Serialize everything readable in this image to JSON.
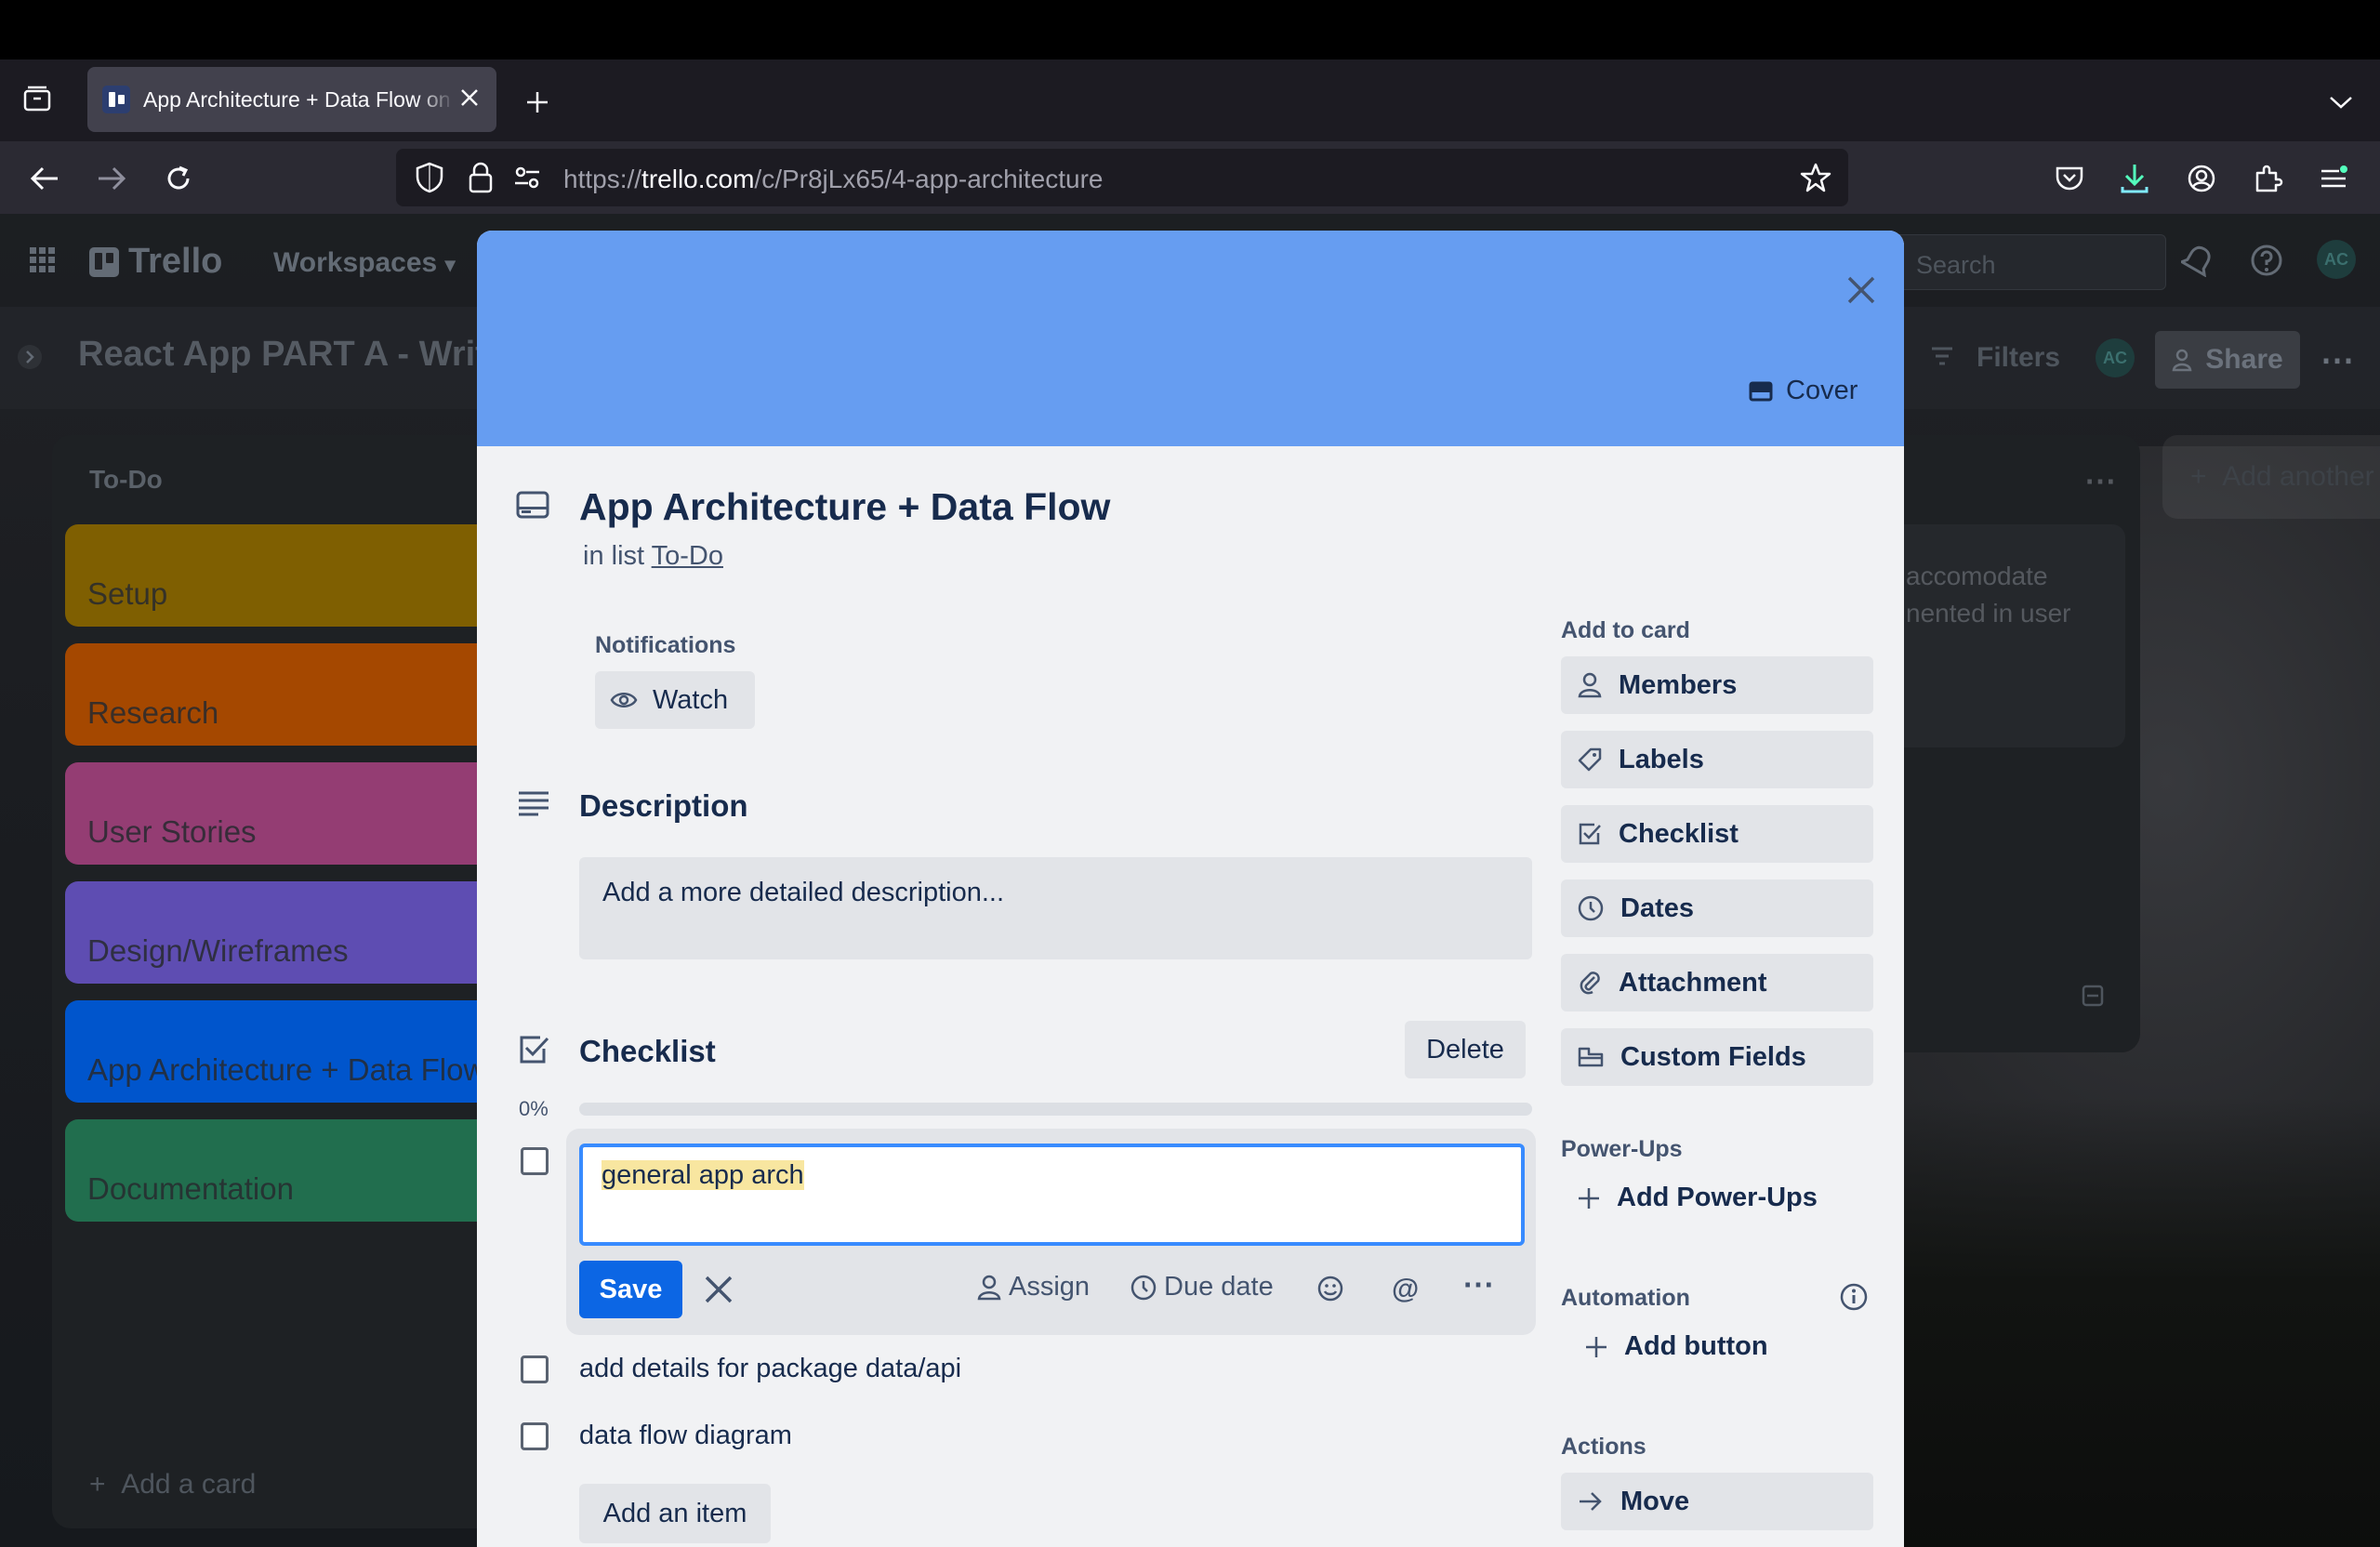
{
  "browser": {
    "tab_title": "App Architecture + Data Flow on",
    "url_prefix": "https://",
    "url_domain": "trello.com",
    "url_path": "/c/Pr8jLx65/4-app-architecture"
  },
  "trello": {
    "logo": "Trello",
    "workspaces": "Workspaces",
    "search_placeholder": "Search",
    "board_title": "React App PART A - Writing",
    "filters": "Filters",
    "share": "Share",
    "avatar_initials": "AC",
    "list": {
      "title": "To-Do",
      "cards": [
        "Setup",
        "Research",
        "User Stories",
        "Design/Wireframes",
        "App Architecture + Data Flow",
        "Documentation"
      ],
      "add_card": "Add a card"
    },
    "right_card_text_1": "accomodate",
    "right_card_text_2": "nented in user",
    "add_list": "Add another list"
  },
  "modal": {
    "cover_label": "Cover",
    "title": "App Architecture + Data Flow",
    "in_list_prefix": "in list",
    "list_name": "To-Do",
    "notifications_label": "Notifications",
    "watch_label": "Watch",
    "description_heading": "Description",
    "description_placeholder": "Add a more detailed description...",
    "checklist_heading": "Checklist",
    "delete_label": "Delete",
    "progress_text": "0%",
    "progress_value": 0,
    "edit_item_value": "general app arch",
    "save_label": "Save",
    "assign_label": "Assign",
    "due_date_label": "Due date",
    "items": [
      "add details for package data/api",
      "data flow diagram"
    ],
    "add_item_label": "Add an item",
    "sidebar": {
      "add_to_card": "Add to card",
      "members": "Members",
      "labels": "Labels",
      "checklist": "Checklist",
      "dates": "Dates",
      "attachment": "Attachment",
      "custom_fields": "Custom Fields",
      "power_ups": "Power-Ups",
      "add_power_ups": "Add Power-Ups",
      "automation": "Automation",
      "add_button": "Add button",
      "actions": "Actions",
      "move": "Move"
    }
  },
  "colors": {
    "cover": "#669df1",
    "save": "#0c66e4",
    "focus": "#388bff",
    "card_setup": "#7f5f01",
    "card_research": "#a54800",
    "card_user_stories": "#943d73",
    "card_design": "#5e4db2",
    "card_arch": "#0055cc",
    "card_docs": "#216e4e"
  }
}
